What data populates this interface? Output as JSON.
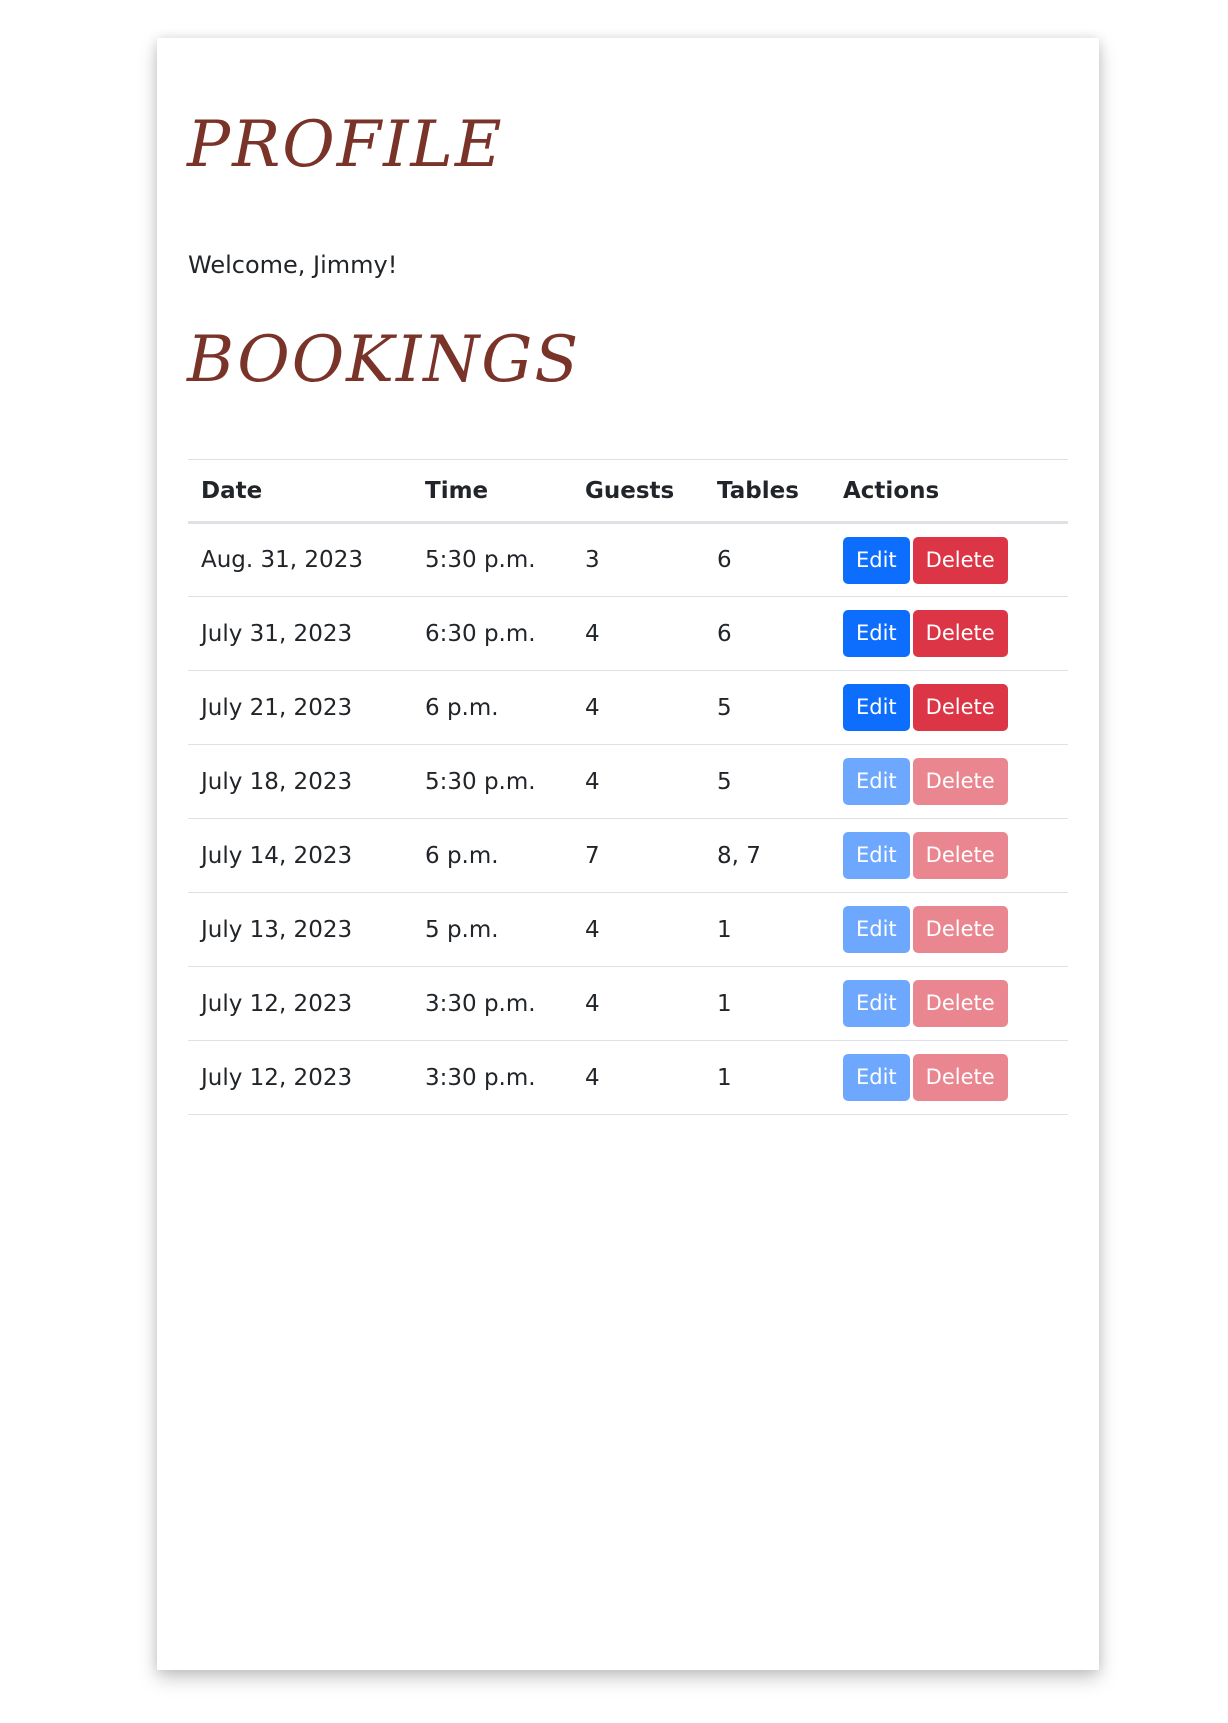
{
  "profile": {
    "title": "PROFILE",
    "welcome": "Welcome, Jimmy!"
  },
  "bookings": {
    "title": "BOOKINGS",
    "columns": [
      "Date",
      "Time",
      "Guests",
      "Tables",
      "Actions"
    ],
    "edit_label": "Edit",
    "delete_label": "Delete",
    "rows": [
      {
        "date": "Aug. 31, 2023",
        "time": "5:30 p.m.",
        "guests": "3",
        "tables": "6",
        "actions_enabled": true
      },
      {
        "date": "July 31, 2023",
        "time": "6:30 p.m.",
        "guests": "4",
        "tables": "6",
        "actions_enabled": true
      },
      {
        "date": "July 21, 2023",
        "time": "6 p.m.",
        "guests": "4",
        "tables": "5",
        "actions_enabled": true
      },
      {
        "date": "July 18, 2023",
        "time": "5:30 p.m.",
        "guests": "4",
        "tables": "5",
        "actions_enabled": false
      },
      {
        "date": "July 14, 2023",
        "time": "6 p.m.",
        "guests": "7",
        "tables": "8, 7",
        "actions_enabled": false
      },
      {
        "date": "July 13, 2023",
        "time": "5 p.m.",
        "guests": "4",
        "tables": "1",
        "actions_enabled": false
      },
      {
        "date": "July 12, 2023",
        "time": "3:30 p.m.",
        "guests": "4",
        "tables": "1",
        "actions_enabled": false
      },
      {
        "date": "July 12, 2023",
        "time": "3:30 p.m.",
        "guests": "4",
        "tables": "1",
        "actions_enabled": false
      }
    ]
  },
  "colors": {
    "heading": "#7a3329",
    "edit_button": "#0d6efd",
    "delete_button": "#dc3545",
    "edit_button_disabled": "#6ea8fe",
    "delete_button_disabled": "#ea868f"
  }
}
